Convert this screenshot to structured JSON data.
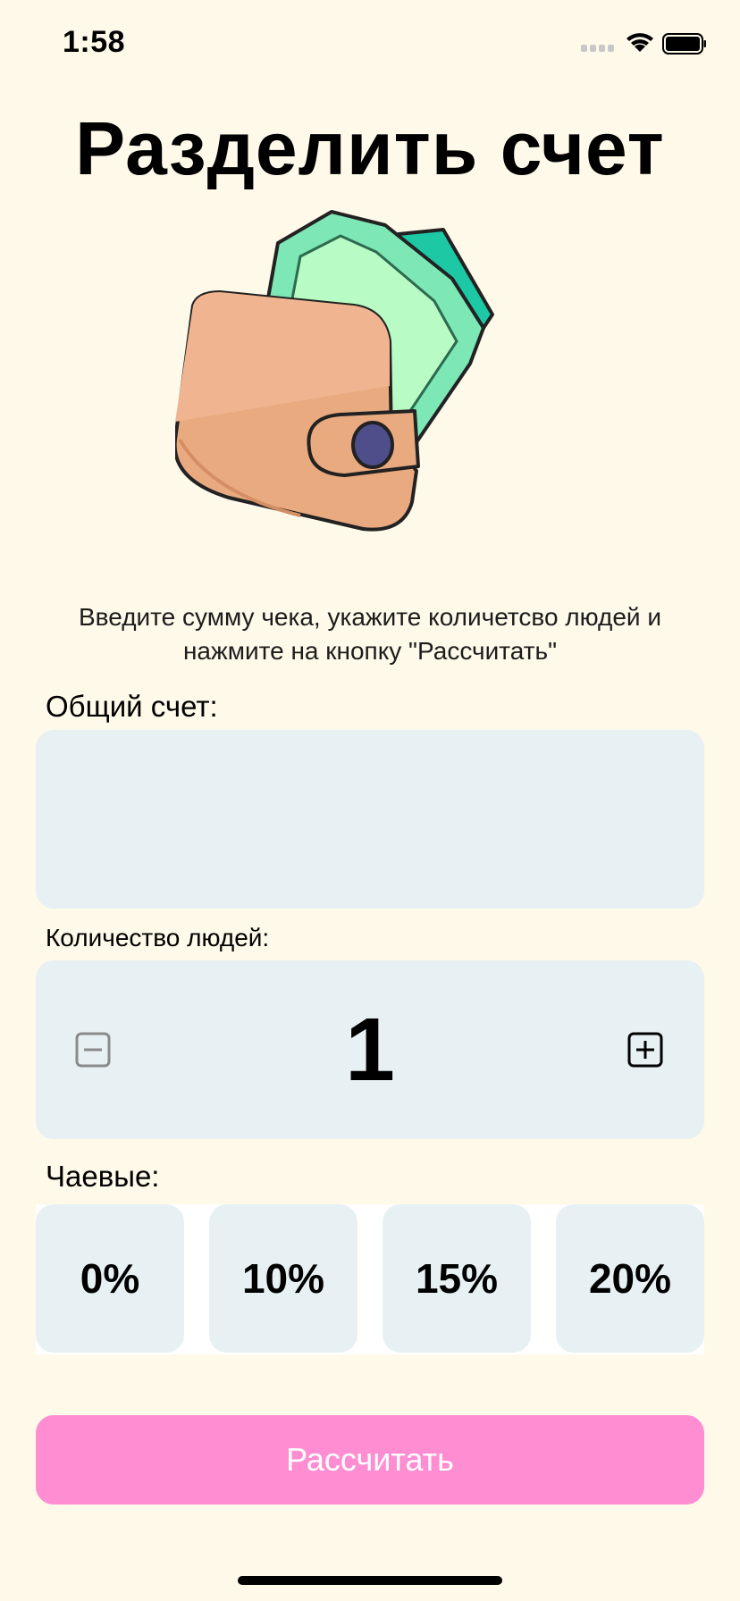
{
  "status_bar": {
    "time": "1:58"
  },
  "title": "Разделить счет",
  "instruction": "Введите сумму чека, укажите количетсво людей и нажмите на кнопку \"Рассчитать\"",
  "total": {
    "label": "Общий счет:",
    "value": ""
  },
  "people": {
    "label": "Количество людей:",
    "count": "1"
  },
  "tips": {
    "label": "Чаевые:",
    "options": [
      "0%",
      "10%",
      "15%",
      "20%"
    ]
  },
  "calculate_button": "Рассчитать",
  "icons": {
    "wallet": "wallet-with-cash-icon",
    "minus": "minus-square-icon",
    "plus": "plus-square-icon",
    "signal": "cellular-signal-icon",
    "wifi": "wifi-icon",
    "battery": "battery-icon"
  },
  "colors": {
    "background": "#FEF9E9",
    "field": "#E7F1F3",
    "button": "#FF8DD2",
    "button_text": "#FFFFFF"
  }
}
